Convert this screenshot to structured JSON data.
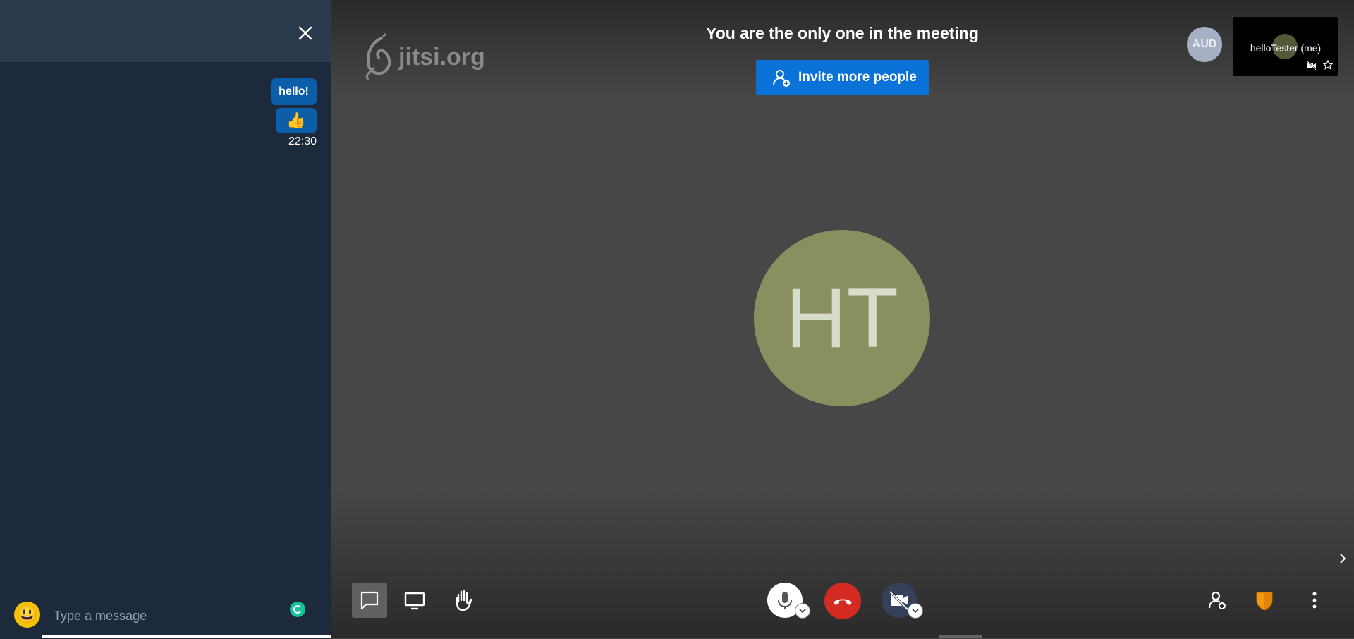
{
  "chat": {
    "messages": [
      {
        "text": "hello!"
      },
      {
        "text": "👍"
      }
    ],
    "timestamp": "22:30",
    "input_placeholder": "Type a message",
    "emoji_glyph": "😃"
  },
  "stage": {
    "logo_text": "jitsi.org",
    "title": "You are the only one in the meeting",
    "invite_label": "Invite more people",
    "audience_badge": "AUD",
    "self_tile_name": "helloTester (me)",
    "main_avatar_initials": "HT"
  },
  "colors": {
    "chat_bg": "#1c2a3c",
    "accent": "#0b73d8",
    "hangup": "#d32b22",
    "avatar": "#8a8f5f"
  }
}
